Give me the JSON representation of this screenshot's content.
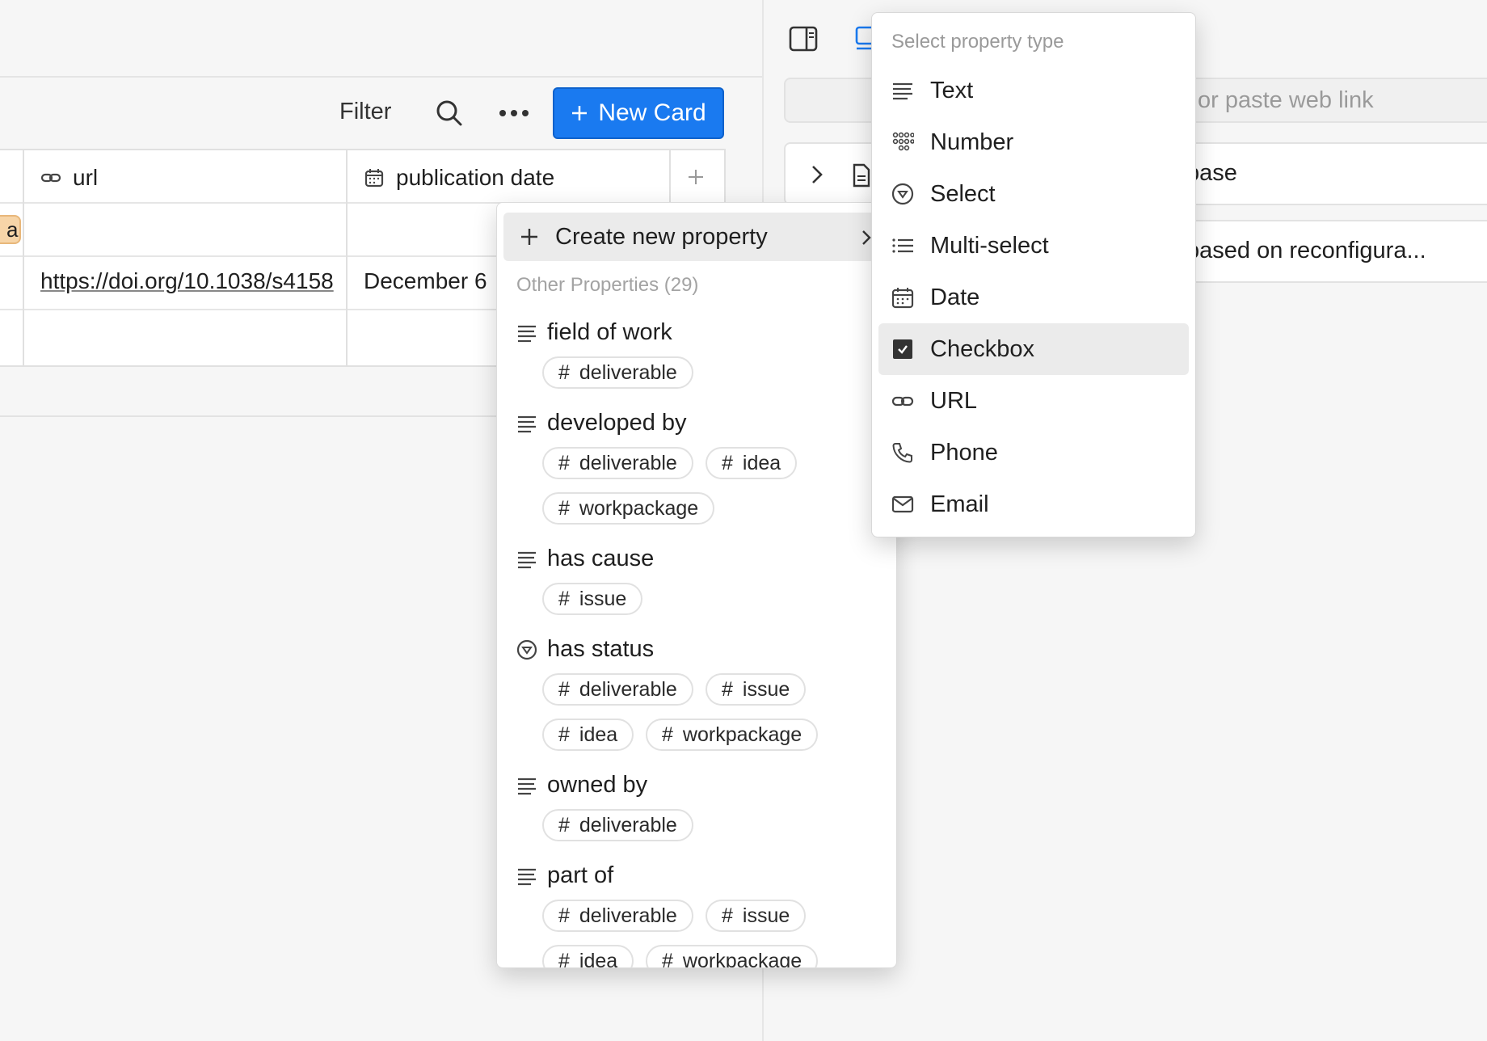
{
  "toolbar": {
    "filter": "Filter",
    "new_card": "New Card",
    "search_icon": "search-icon",
    "more_icon": "more-icon"
  },
  "table": {
    "columns": [
      {
        "label": "url",
        "icon": "link-icon"
      },
      {
        "label": "publication date",
        "icon": "calendar-icon"
      }
    ],
    "rows": [
      {
        "tag": "ar",
        "url": "",
        "date": ""
      },
      {
        "tag": "",
        "url": "https://doi.org/10.1038/s4158",
        "date": "December 6"
      },
      {
        "tag": "",
        "url": "",
        "date": ""
      }
    ],
    "tag_color": "#f7d5a8"
  },
  "right_pane": {
    "link_input_text": "or paste web link",
    "row1_text": "base",
    "row2_text": "based on reconfigura..."
  },
  "property_menu": {
    "create_label": "Create new property",
    "other_label": "Other Properties (29)",
    "properties": [
      {
        "name": "field of work",
        "icon": "text-icon",
        "tags": [
          "deliverable"
        ]
      },
      {
        "name": "developed by",
        "icon": "text-icon",
        "tags": [
          "deliverable",
          "idea",
          "workpackage"
        ]
      },
      {
        "name": "has cause",
        "icon": "text-icon",
        "tags": [
          "issue"
        ]
      },
      {
        "name": "has status",
        "icon": "select-icon",
        "tags": [
          "deliverable",
          "issue",
          "idea",
          "workpackage"
        ]
      },
      {
        "name": "owned by",
        "icon": "text-icon",
        "tags": [
          "deliverable"
        ]
      },
      {
        "name": "part of",
        "icon": "text-icon",
        "tags": [
          "deliverable",
          "issue",
          "idea",
          "workpackage"
        ]
      }
    ]
  },
  "type_menu": {
    "header": "Select property type",
    "items": [
      {
        "label": "Text",
        "icon": "text-icon"
      },
      {
        "label": "Number",
        "icon": "number-icon"
      },
      {
        "label": "Select",
        "icon": "select-icon"
      },
      {
        "label": "Multi-select",
        "icon": "multi-select-icon"
      },
      {
        "label": "Date",
        "icon": "calendar-icon"
      },
      {
        "label": "Checkbox",
        "icon": "checkbox-icon",
        "active": true
      },
      {
        "label": "URL",
        "icon": "link-icon"
      },
      {
        "label": "Phone",
        "icon": "phone-icon"
      },
      {
        "label": "Email",
        "icon": "email-icon"
      }
    ]
  },
  "colors": {
    "accent": "#1a7af0",
    "hover": "#ebebeb"
  }
}
